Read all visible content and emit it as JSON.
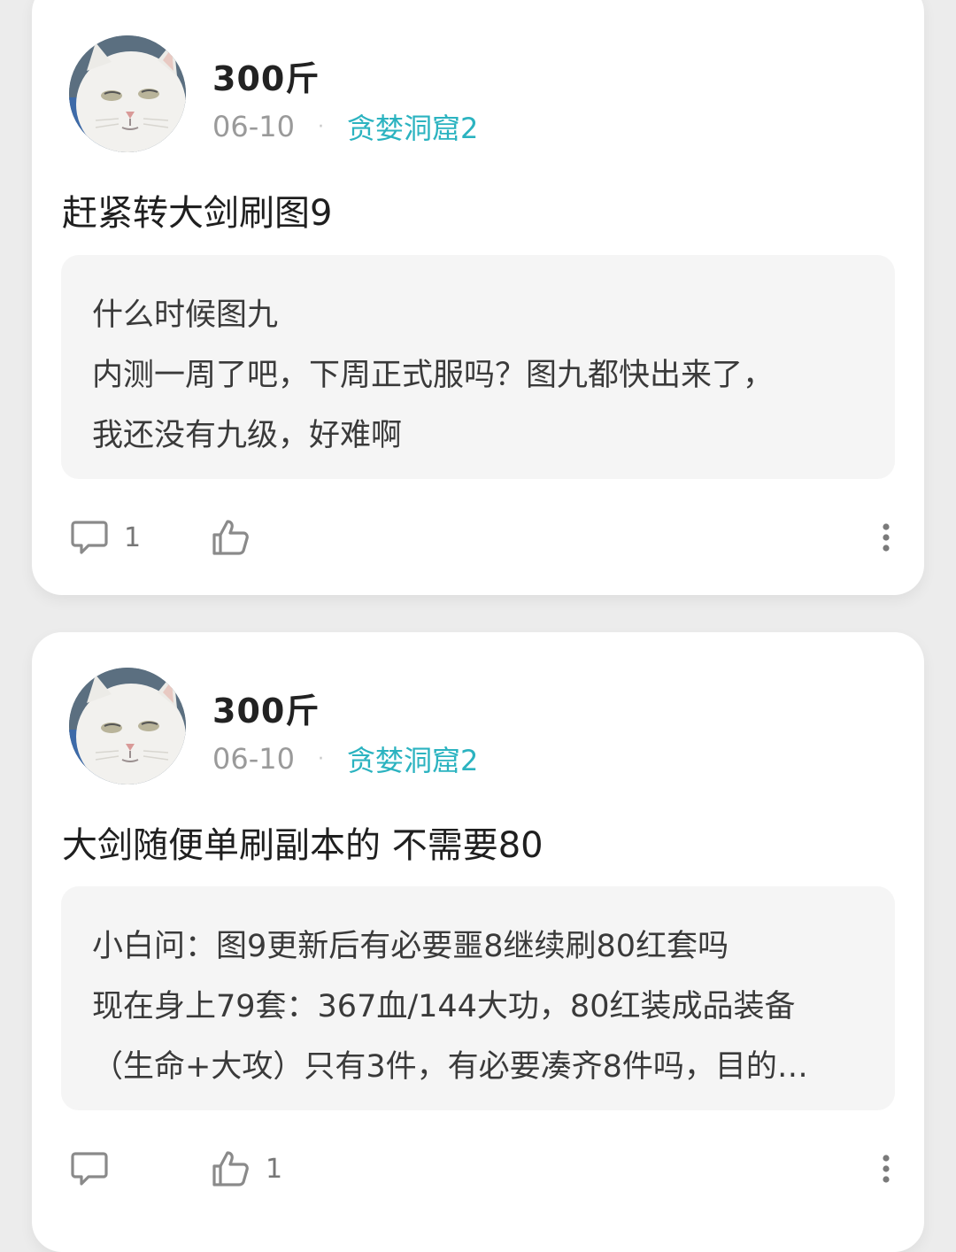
{
  "posts": [
    {
      "author": "300斤",
      "date": "06-10",
      "separator": "·",
      "forum": "贪婪洞窟2",
      "text": "赶紧转大剑刷图9",
      "quote_lines": [
        "什么时候图九",
        "内测一周了吧，下周正式服吗？图九都快出来了，",
        "我还没有九级，好难啊"
      ],
      "comment_count": "1",
      "like_count": ""
    },
    {
      "author": "300斤",
      "date": "06-10",
      "separator": "·",
      "forum": "贪婪洞窟2",
      "text": "大剑随便单刷副本的 不需要80",
      "quote_lines": [
        "小白问：图9更新后有必要噩8继续刷80红套吗",
        "现在身上79套：367血/144大功，80红装成品装备",
        "（生命+大攻）只有3件，有必要凑齐8件吗，目的…"
      ],
      "comment_count": "",
      "like_count": "1"
    }
  ],
  "icons": {
    "avatar": "white-cat-avatar",
    "comment": "comment-icon",
    "like": "thumbs-up-icon",
    "more": "more-vertical-icon"
  },
  "colors": {
    "background": "#ececec",
    "card": "#ffffff",
    "quote_bg": "#f5f5f5",
    "forum_link": "#2bb3c0",
    "meta_gray": "#9a9a9a"
  }
}
